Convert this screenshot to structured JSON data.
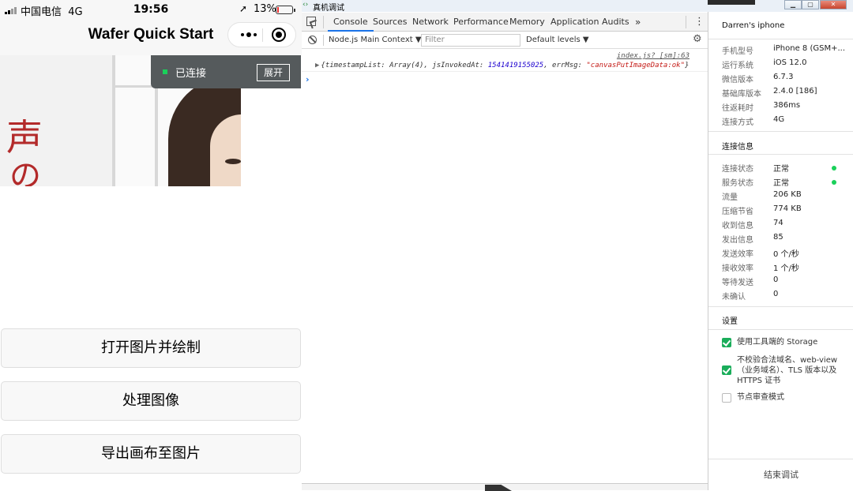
{
  "phone": {
    "status": {
      "carrier": "中国电信",
      "network": "4G",
      "time": "19:56",
      "battery": "13%",
      "battery_level": 0.13
    },
    "nav_title": "Wafer Quick Start",
    "photo_chars": [
      "声",
      "の"
    ],
    "connection": {
      "status": "已连接",
      "expand_label": "展开"
    },
    "buttons": [
      "打开图片并绘制",
      "处理图像",
      "导出画布至图片"
    ]
  },
  "devtools": {
    "window_title": "真机调试",
    "tabs": [
      "Console",
      "Sources",
      "Network",
      "Performance",
      "Memory",
      "Application",
      "Audits"
    ],
    "more_tabs": "»",
    "context": "Node.js Main Context ▼",
    "filter_placeholder": "Filter",
    "levels": "Default levels ▼",
    "message": {
      "source": "index.js? [sm]:63",
      "prefix": "{timestampList: Array(4), jsInvokedAt: ",
      "timestamp": "1541419155025",
      "middle": ", errMsg: ",
      "errmsg": "\"canvasPutImageData:ok\"",
      "suffix": "}"
    }
  },
  "info": {
    "device_name": "Darren's iphone",
    "device_rows": [
      {
        "k": "手机型号",
        "v": "iPhone 8 (GSM+..."
      },
      {
        "k": "运行系统",
        "v": "iOS 12.0"
      },
      {
        "k": "微信版本",
        "v": "6.7.3"
      },
      {
        "k": "基础库版本",
        "v": "2.4.0 [186]"
      },
      {
        "k": "往返耗时",
        "v": "386ms"
      },
      {
        "k": "连接方式",
        "v": "4G"
      }
    ],
    "conn_title": "连接信息",
    "conn_rows": [
      {
        "k": "连接状态",
        "v": "正常"
      },
      {
        "k": "服务状态",
        "v": "正常"
      },
      {
        "k": "流量",
        "v": "206 KB"
      },
      {
        "k": "压缩节省",
        "v": "774 KB"
      },
      {
        "k": "收到信息",
        "v": "74"
      },
      {
        "k": "发出信息",
        "v": "85"
      },
      {
        "k": "发送效率",
        "v": "0 个/秒"
      },
      {
        "k": "接收效率",
        "v": "1 个/秒"
      },
      {
        "k": "等待发送",
        "v": "0"
      },
      {
        "k": "未确认",
        "v": "0"
      }
    ],
    "settings_title": "设置",
    "settings": [
      {
        "label": "使用工具端的 Storage",
        "checked": true
      },
      {
        "label": "不校验合法域名、web-view（业务域名）、TLS 版本以及 HTTPS 证书",
        "checked": true
      },
      {
        "label": "节点审查模式",
        "checked": false
      }
    ],
    "end_label": "结束调试"
  },
  "colors": {
    "accent_green": "#1ad05a",
    "check_green": "#1aad5a",
    "tab_underline": "#1a73e8"
  }
}
